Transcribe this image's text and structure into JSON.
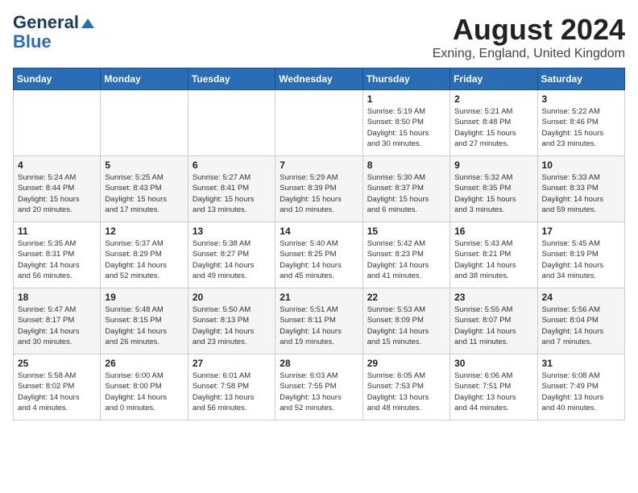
{
  "header": {
    "logo_line1": "General",
    "logo_line2": "Blue",
    "month_year": "August 2024",
    "location": "Exning, England, United Kingdom"
  },
  "weekdays": [
    "Sunday",
    "Monday",
    "Tuesday",
    "Wednesday",
    "Thursday",
    "Friday",
    "Saturday"
  ],
  "weeks": [
    [
      {
        "day": "",
        "content": ""
      },
      {
        "day": "",
        "content": ""
      },
      {
        "day": "",
        "content": ""
      },
      {
        "day": "",
        "content": ""
      },
      {
        "day": "1",
        "content": "Sunrise: 5:19 AM\nSunset: 8:50 PM\nDaylight: 15 hours\nand 30 minutes."
      },
      {
        "day": "2",
        "content": "Sunrise: 5:21 AM\nSunset: 8:48 PM\nDaylight: 15 hours\nand 27 minutes."
      },
      {
        "day": "3",
        "content": "Sunrise: 5:22 AM\nSunset: 8:46 PM\nDaylight: 15 hours\nand 23 minutes."
      }
    ],
    [
      {
        "day": "4",
        "content": "Sunrise: 5:24 AM\nSunset: 8:44 PM\nDaylight: 15 hours\nand 20 minutes."
      },
      {
        "day": "5",
        "content": "Sunrise: 5:25 AM\nSunset: 8:43 PM\nDaylight: 15 hours\nand 17 minutes."
      },
      {
        "day": "6",
        "content": "Sunrise: 5:27 AM\nSunset: 8:41 PM\nDaylight: 15 hours\nand 13 minutes."
      },
      {
        "day": "7",
        "content": "Sunrise: 5:29 AM\nSunset: 8:39 PM\nDaylight: 15 hours\nand 10 minutes."
      },
      {
        "day": "8",
        "content": "Sunrise: 5:30 AM\nSunset: 8:37 PM\nDaylight: 15 hours\nand 6 minutes."
      },
      {
        "day": "9",
        "content": "Sunrise: 5:32 AM\nSunset: 8:35 PM\nDaylight: 15 hours\nand 3 minutes."
      },
      {
        "day": "10",
        "content": "Sunrise: 5:33 AM\nSunset: 8:33 PM\nDaylight: 14 hours\nand 59 minutes."
      }
    ],
    [
      {
        "day": "11",
        "content": "Sunrise: 5:35 AM\nSunset: 8:31 PM\nDaylight: 14 hours\nand 56 minutes."
      },
      {
        "day": "12",
        "content": "Sunrise: 5:37 AM\nSunset: 8:29 PM\nDaylight: 14 hours\nand 52 minutes."
      },
      {
        "day": "13",
        "content": "Sunrise: 5:38 AM\nSunset: 8:27 PM\nDaylight: 14 hours\nand 49 minutes."
      },
      {
        "day": "14",
        "content": "Sunrise: 5:40 AM\nSunset: 8:25 PM\nDaylight: 14 hours\nand 45 minutes."
      },
      {
        "day": "15",
        "content": "Sunrise: 5:42 AM\nSunset: 8:23 PM\nDaylight: 14 hours\nand 41 minutes."
      },
      {
        "day": "16",
        "content": "Sunrise: 5:43 AM\nSunset: 8:21 PM\nDaylight: 14 hours\nand 38 minutes."
      },
      {
        "day": "17",
        "content": "Sunrise: 5:45 AM\nSunset: 8:19 PM\nDaylight: 14 hours\nand 34 minutes."
      }
    ],
    [
      {
        "day": "18",
        "content": "Sunrise: 5:47 AM\nSunset: 8:17 PM\nDaylight: 14 hours\nand 30 minutes."
      },
      {
        "day": "19",
        "content": "Sunrise: 5:48 AM\nSunset: 8:15 PM\nDaylight: 14 hours\nand 26 minutes."
      },
      {
        "day": "20",
        "content": "Sunrise: 5:50 AM\nSunset: 8:13 PM\nDaylight: 14 hours\nand 23 minutes."
      },
      {
        "day": "21",
        "content": "Sunrise: 5:51 AM\nSunset: 8:11 PM\nDaylight: 14 hours\nand 19 minutes."
      },
      {
        "day": "22",
        "content": "Sunrise: 5:53 AM\nSunset: 8:09 PM\nDaylight: 14 hours\nand 15 minutes."
      },
      {
        "day": "23",
        "content": "Sunrise: 5:55 AM\nSunset: 8:07 PM\nDaylight: 14 hours\nand 11 minutes."
      },
      {
        "day": "24",
        "content": "Sunrise: 5:56 AM\nSunset: 8:04 PM\nDaylight: 14 hours\nand 7 minutes."
      }
    ],
    [
      {
        "day": "25",
        "content": "Sunrise: 5:58 AM\nSunset: 8:02 PM\nDaylight: 14 hours\nand 4 minutes."
      },
      {
        "day": "26",
        "content": "Sunrise: 6:00 AM\nSunset: 8:00 PM\nDaylight: 14 hours\nand 0 minutes."
      },
      {
        "day": "27",
        "content": "Sunrise: 6:01 AM\nSunset: 7:58 PM\nDaylight: 13 hours\nand 56 minutes."
      },
      {
        "day": "28",
        "content": "Sunrise: 6:03 AM\nSunset: 7:55 PM\nDaylight: 13 hours\nand 52 minutes."
      },
      {
        "day": "29",
        "content": "Sunrise: 6:05 AM\nSunset: 7:53 PM\nDaylight: 13 hours\nand 48 minutes."
      },
      {
        "day": "30",
        "content": "Sunrise: 6:06 AM\nSunset: 7:51 PM\nDaylight: 13 hours\nand 44 minutes."
      },
      {
        "day": "31",
        "content": "Sunrise: 6:08 AM\nSunset: 7:49 PM\nDaylight: 13 hours\nand 40 minutes."
      }
    ]
  ]
}
